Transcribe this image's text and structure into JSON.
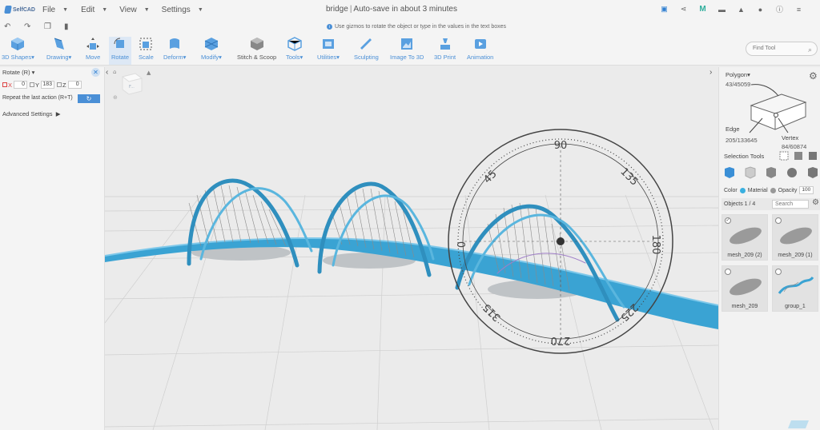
{
  "app": {
    "logo_text": "SelfCAD",
    "document_name": "bridge",
    "autosave": "Auto-save in about 3 minutes"
  },
  "menu": [
    "File",
    "Edit",
    "View",
    "Settings"
  ],
  "hint": "Use gizmos to rotate the object or type in the values in the text boxes",
  "toolbar": {
    "items": [
      "3D Shapes",
      "Drawing",
      "Move",
      "Rotate",
      "Scale",
      "Deform",
      "Modify",
      "Stitch & Scoop",
      "Tools",
      "Utilities",
      "Sculpting",
      "Image To 3D",
      "3D Print",
      "Animation"
    ],
    "active": "Rotate",
    "find_placeholder": "Find Tool"
  },
  "rotate_panel": {
    "title": "Rotate (R)",
    "x_label": "X",
    "x_value": "0",
    "y_label": "Y",
    "y_value": "183",
    "z_label": "Z",
    "z_value": "0",
    "repeat_label": "Repeat the last action (R+T)",
    "advanced_label": "Advanced Settings"
  },
  "gizmo": {
    "labels": [
      "90",
      "135",
      "180",
      "225",
      "270",
      "315",
      "0",
      "45"
    ]
  },
  "selection": {
    "polygon_label": "Polygon",
    "polygon_value": "43/45059",
    "edge_label": "Edge",
    "edge_value": "205/133645",
    "vertex_label": "Vertex",
    "vertex_value": "84/60874",
    "tools_label": "Selection Tools",
    "color_label": "Color",
    "material_label": "Material",
    "opacity_label": "Opacity",
    "opacity_value": "100"
  },
  "objects": {
    "count": "Objects 1 / 4",
    "search_placeholder": "Search",
    "items": [
      {
        "name": "mesh_209 (2)",
        "selected": true
      },
      {
        "name": "mesh_209 (1)",
        "selected": false
      },
      {
        "name": "mesh_209",
        "selected": false
      },
      {
        "name": "group_1",
        "selected": false
      }
    ]
  },
  "colors": {
    "accent": "#4a8fd6",
    "bridge": "#3aa3d3",
    "viewport_bg": "#ebebeb"
  }
}
